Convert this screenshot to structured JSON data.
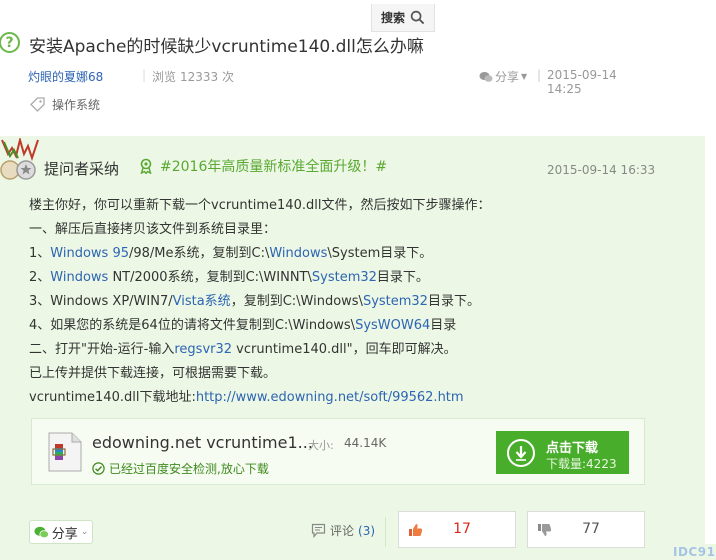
{
  "search": {
    "label": "搜索",
    "icon": "search-icon"
  },
  "question": {
    "title": "安装Apache的时候缺少vcruntime140.dll怎么办嘛",
    "author": "灼眼的夏娜68",
    "views_label": "浏览",
    "views": "12333 次",
    "share_label": "分享",
    "date": "2015-09-14 14:25",
    "tag": "操作系统"
  },
  "answer": {
    "adopted_label": "提问者采纳",
    "topic": "#2016年高质量新标准全面升级！#",
    "date": "2015-09-14 16:33",
    "lines": {
      "l0": "楼主你好，你可以重新下载一个vcruntime140.dll文件，然后按如下步骤操作：",
      "l1": "一、解压后直接拷贝该文件到系统目录里：",
      "l2": {
        "a": "1、",
        "b": "Windows 95",
        "c": "/98/Me系统，复制到C:\\",
        "d": "Windows",
        "e": "\\System目录下。"
      },
      "l3": {
        "a": "2、",
        "b": "Windows",
        "c": " NT/2000系统，复制到C:\\WINNT\\",
        "d": "System32",
        "e": "目录下。"
      },
      "l4": {
        "a": "3、Windows XP/WIN7/",
        "b": "Vista系统",
        "c": "，复制到C:\\Windows\\",
        "d": "System32",
        "e": "目录下。"
      },
      "l5": {
        "a": "4、如果您的系统是64位的请将文件复制到C:\\Windows\\",
        "b": "SysWOW64",
        "c": "目录"
      },
      "l6": {
        "a": "二、打开\"开始-运行-输入",
        "b": "regsvr32",
        "c": " vcruntime140.dll\"，回车即可解决。"
      },
      "l7": "已上传并提供下载连接，可根据需要下载。",
      "l8": {
        "a": "vcruntime140.dll下载地址:",
        "b": "http://www.edowning.net/soft/99562.htm"
      }
    },
    "download": {
      "name": "edowning.net vcruntime1...",
      "size_label": "大小:",
      "size": "44.14K",
      "safe_text": "已经过百度安全检测,放心下载",
      "button_label": "点击下载",
      "download_count": "下载量:4223"
    },
    "actions": {
      "share_label": "分享",
      "comment_label": "评论",
      "comment_count": "(3)",
      "upvotes": "17",
      "downvotes": "77"
    }
  },
  "watermark": "IDC91",
  "colors": {
    "accent_green": "#49ad2c",
    "answer_bg": "#ecf8e5",
    "link_blue": "#2d64b3",
    "upvote_red": "#d9261c"
  }
}
